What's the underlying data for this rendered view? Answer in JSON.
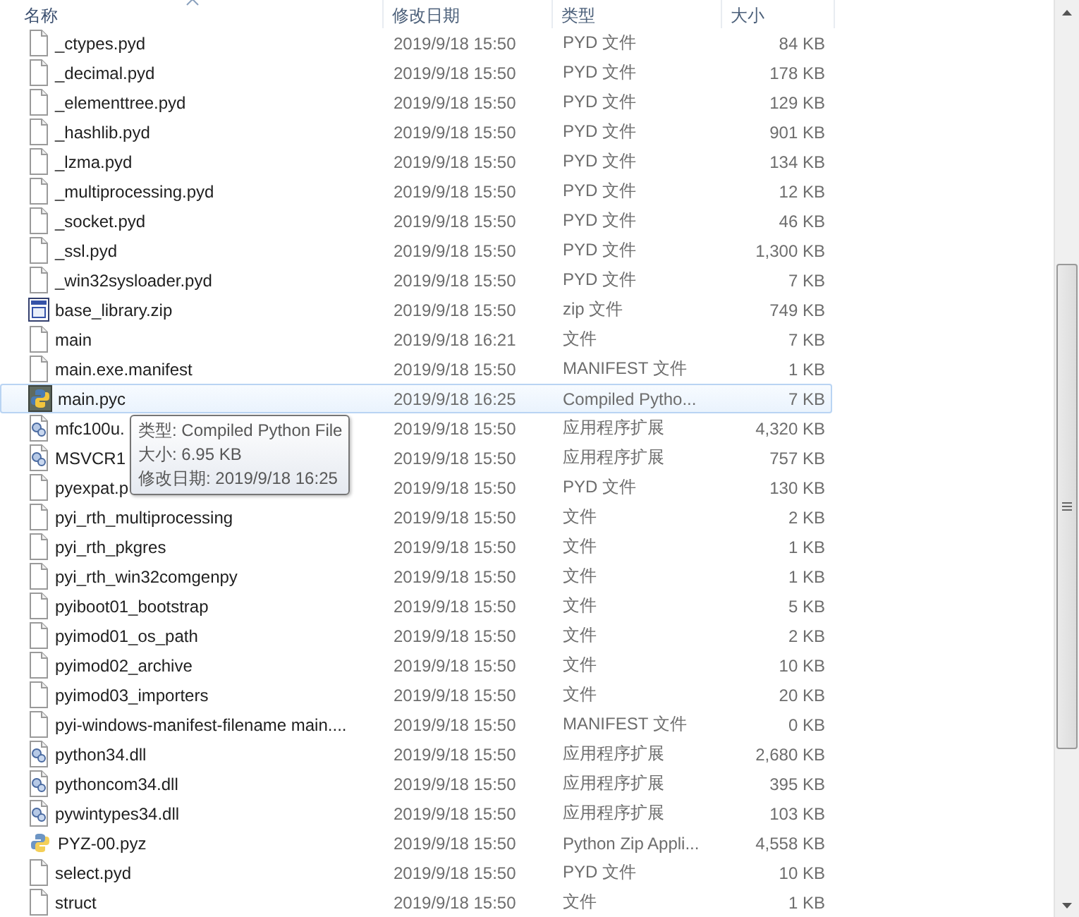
{
  "columns": [
    {
      "label": "名称",
      "sorted": true
    },
    {
      "label": "修改日期",
      "sorted": false
    },
    {
      "label": "类型",
      "sorted": false
    },
    {
      "label": "大小",
      "sorted": false
    }
  ],
  "rows": [
    {
      "name": "_ctypes.pyd",
      "kind": "file",
      "date": "2019/9/18 15:50",
      "type": "PYD 文件",
      "size": "84 KB",
      "selected": false
    },
    {
      "name": "_decimal.pyd",
      "kind": "file",
      "date": "2019/9/18 15:50",
      "type": "PYD 文件",
      "size": "178 KB",
      "selected": false
    },
    {
      "name": "_elementtree.pyd",
      "kind": "file",
      "date": "2019/9/18 15:50",
      "type": "PYD 文件",
      "size": "129 KB",
      "selected": false
    },
    {
      "name": "_hashlib.pyd",
      "kind": "file",
      "date": "2019/9/18 15:50",
      "type": "PYD 文件",
      "size": "901 KB",
      "selected": false
    },
    {
      "name": "_lzma.pyd",
      "kind": "file",
      "date": "2019/9/18 15:50",
      "type": "PYD 文件",
      "size": "134 KB",
      "selected": false
    },
    {
      "name": "_multiprocessing.pyd",
      "kind": "file",
      "date": "2019/9/18 15:50",
      "type": "PYD 文件",
      "size": "12 KB",
      "selected": false
    },
    {
      "name": "_socket.pyd",
      "kind": "file",
      "date": "2019/9/18 15:50",
      "type": "PYD 文件",
      "size": "46 KB",
      "selected": false
    },
    {
      "name": "_ssl.pyd",
      "kind": "file",
      "date": "2019/9/18 15:50",
      "type": "PYD 文件",
      "size": "1,300 KB",
      "selected": false
    },
    {
      "name": "_win32sysloader.pyd",
      "kind": "file",
      "date": "2019/9/18 15:50",
      "type": "PYD 文件",
      "size": "7 KB",
      "selected": false
    },
    {
      "name": "base_library.zip",
      "kind": "zip",
      "date": "2019/9/18 15:50",
      "type": "zip 文件",
      "size": "749 KB",
      "selected": false
    },
    {
      "name": "main",
      "kind": "file",
      "date": "2019/9/18 16:21",
      "type": "文件",
      "size": "7 KB",
      "selected": false
    },
    {
      "name": "main.exe.manifest",
      "kind": "file",
      "date": "2019/9/18 15:50",
      "type": "MANIFEST 文件",
      "size": "1 KB",
      "selected": false
    },
    {
      "name": "main.pyc",
      "kind": "python",
      "date": "2019/9/18 16:25",
      "type": "Compiled Pytho...",
      "size": "7 KB",
      "selected": true
    },
    {
      "name": "mfc100u.",
      "kind": "dll",
      "date": "2019/9/18 15:50",
      "type": "应用程序扩展",
      "size": "4,320 KB",
      "selected": false
    },
    {
      "name": "MSVCR1",
      "kind": "dll",
      "date": "2019/9/18 15:50",
      "type": "应用程序扩展",
      "size": "757 KB",
      "selected": false
    },
    {
      "name": "pyexpat.p",
      "kind": "file",
      "date": "2019/9/18 15:50",
      "type": "PYD 文件",
      "size": "130 KB",
      "selected": false
    },
    {
      "name": "pyi_rth_multiprocessing",
      "kind": "file",
      "date": "2019/9/18 15:50",
      "type": "文件",
      "size": "2 KB",
      "selected": false
    },
    {
      "name": "pyi_rth_pkgres",
      "kind": "file",
      "date": "2019/9/18 15:50",
      "type": "文件",
      "size": "1 KB",
      "selected": false
    },
    {
      "name": "pyi_rth_win32comgenpy",
      "kind": "file",
      "date": "2019/9/18 15:50",
      "type": "文件",
      "size": "1 KB",
      "selected": false
    },
    {
      "name": "pyiboot01_bootstrap",
      "kind": "file",
      "date": "2019/9/18 15:50",
      "type": "文件",
      "size": "5 KB",
      "selected": false
    },
    {
      "name": "pyimod01_os_path",
      "kind": "file",
      "date": "2019/9/18 15:50",
      "type": "文件",
      "size": "2 KB",
      "selected": false
    },
    {
      "name": "pyimod02_archive",
      "kind": "file",
      "date": "2019/9/18 15:50",
      "type": "文件",
      "size": "10 KB",
      "selected": false
    },
    {
      "name": "pyimod03_importers",
      "kind": "file",
      "date": "2019/9/18 15:50",
      "type": "文件",
      "size": "20 KB",
      "selected": false
    },
    {
      "name": "pyi-windows-manifest-filename main....",
      "kind": "file",
      "date": "2019/9/18 15:50",
      "type": "MANIFEST 文件",
      "size": "0 KB",
      "selected": false
    },
    {
      "name": "python34.dll",
      "kind": "dll",
      "date": "2019/9/18 15:50",
      "type": "应用程序扩展",
      "size": "2,680 KB",
      "selected": false
    },
    {
      "name": "pythoncom34.dll",
      "kind": "dll",
      "date": "2019/9/18 15:50",
      "type": "应用程序扩展",
      "size": "395 KB",
      "selected": false
    },
    {
      "name": "pywintypes34.dll",
      "kind": "dll",
      "date": "2019/9/18 15:50",
      "type": "应用程序扩展",
      "size": "103 KB",
      "selected": false
    },
    {
      "name": "PYZ-00.pyz",
      "kind": "pyz",
      "date": "2019/9/18 15:50",
      "type": "Python Zip Appli...",
      "size": "4,558 KB",
      "selected": false
    },
    {
      "name": "select.pyd",
      "kind": "file",
      "date": "2019/9/18 15:50",
      "type": "PYD 文件",
      "size": "10 KB",
      "selected": false
    },
    {
      "name": "struct",
      "kind": "file",
      "date": "2019/9/18 15:50",
      "type": "文件",
      "size": "1 KB",
      "selected": false
    }
  ],
  "tooltip": {
    "lines": [
      "类型: Compiled Python File",
      "大小: 6.95 KB",
      "修改日期: 2019/9/18 16:25"
    ]
  }
}
